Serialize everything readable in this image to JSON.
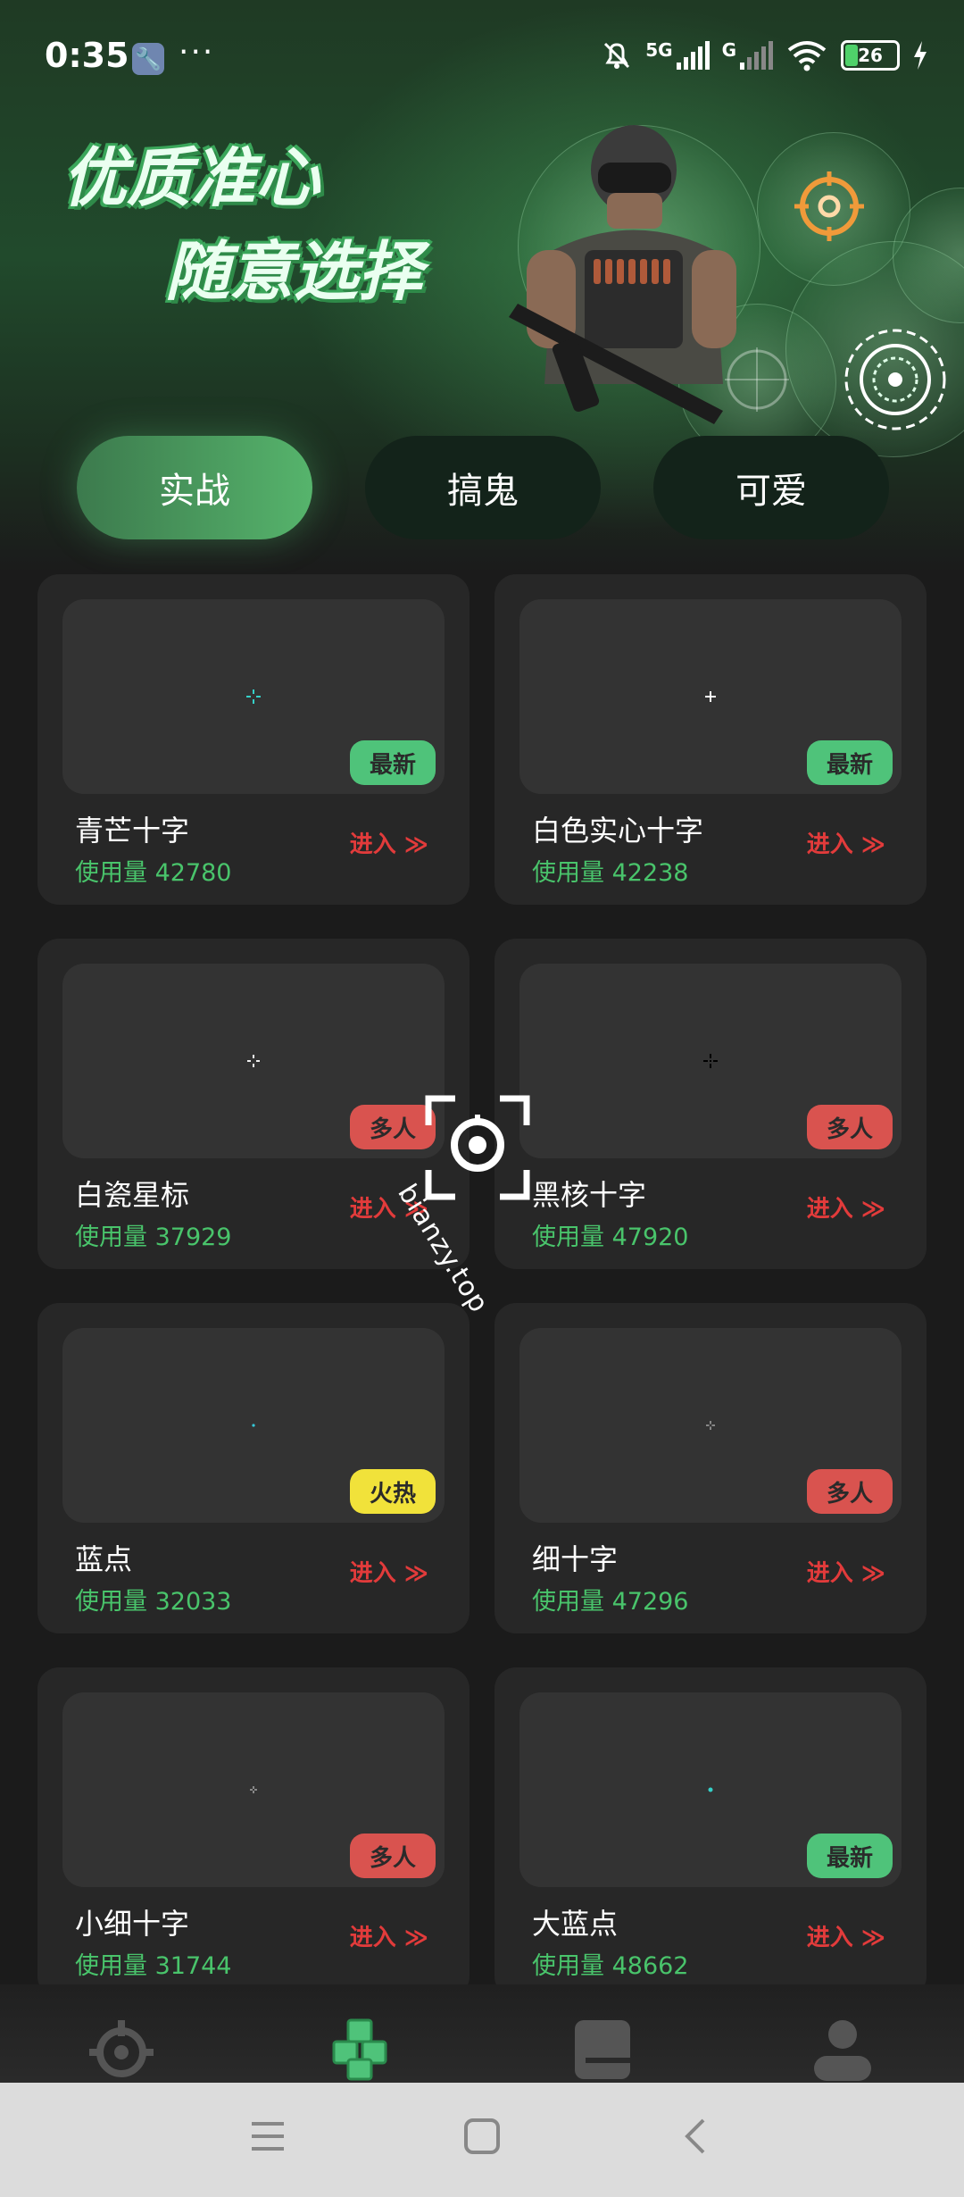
{
  "status_bar": {
    "time": "0:35",
    "dots": "···",
    "network_5g": "5G",
    "network_g": "G",
    "battery": "26"
  },
  "hero": {
    "headline_line1": "优质准心",
    "headline_line2": "随意选择"
  },
  "tabs": [
    {
      "label": "实战",
      "active": true
    },
    {
      "label": "搞鬼",
      "active": false
    },
    {
      "label": "可爱",
      "active": false
    }
  ],
  "cards": [
    {
      "name": "青芒十字",
      "usage": "使用量 42780",
      "badge": "最新",
      "badge_type": "new",
      "enter": "进入 ≫",
      "crosshair_color": "#35d0c8"
    },
    {
      "name": "白色实心十字",
      "usage": "使用量 42238",
      "badge": "最新",
      "badge_type": "new",
      "enter": "进入 ≫",
      "crosshair_color": "#ffffff"
    },
    {
      "name": "白瓷星标",
      "usage": "使用量 37929",
      "badge": "多人",
      "badge_type": "multi",
      "enter": "进入 ≫",
      "crosshair_color": "#f0f0f0"
    },
    {
      "name": "黑核十字",
      "usage": "使用量 47920",
      "badge": "多人",
      "badge_type": "multi",
      "enter": "进入 ≫",
      "crosshair_color": "#000000"
    },
    {
      "name": "蓝点",
      "usage": "使用量 32033",
      "badge": "火热",
      "badge_type": "hot",
      "enter": "进入 ≫",
      "crosshair_color": "#35c8d8"
    },
    {
      "name": "细十字",
      "usage": "使用量 47296",
      "badge": "多人",
      "badge_type": "multi",
      "enter": "进入 ≫",
      "crosshair_color": "#dddddd"
    },
    {
      "name": "小细十字",
      "usage": "使用量 31744",
      "badge": "多人",
      "badge_type": "multi",
      "enter": "进入 ≫",
      "crosshair_color": "#dddddd"
    },
    {
      "name": "大蓝点",
      "usage": "使用量 48662",
      "badge": "最新",
      "badge_type": "new",
      "enter": "进入 ≫",
      "crosshair_color": "#35d0c8"
    }
  ],
  "watermark": {
    "text": "bianzy.top"
  },
  "bottom_nav": [
    {
      "icon": "crosshair-icon",
      "active": false
    },
    {
      "icon": "cubes-icon",
      "active": true
    },
    {
      "icon": "book-icon",
      "active": false
    },
    {
      "icon": "user-icon",
      "active": false
    }
  ],
  "system_nav": [
    "menu-icon",
    "home-icon",
    "back-icon"
  ],
  "colors": {
    "accent": "#4fc37a",
    "enter": "#e23b3b",
    "usage": "#49c46b",
    "hot": "#f1e23a",
    "multi": "#d9534f"
  }
}
